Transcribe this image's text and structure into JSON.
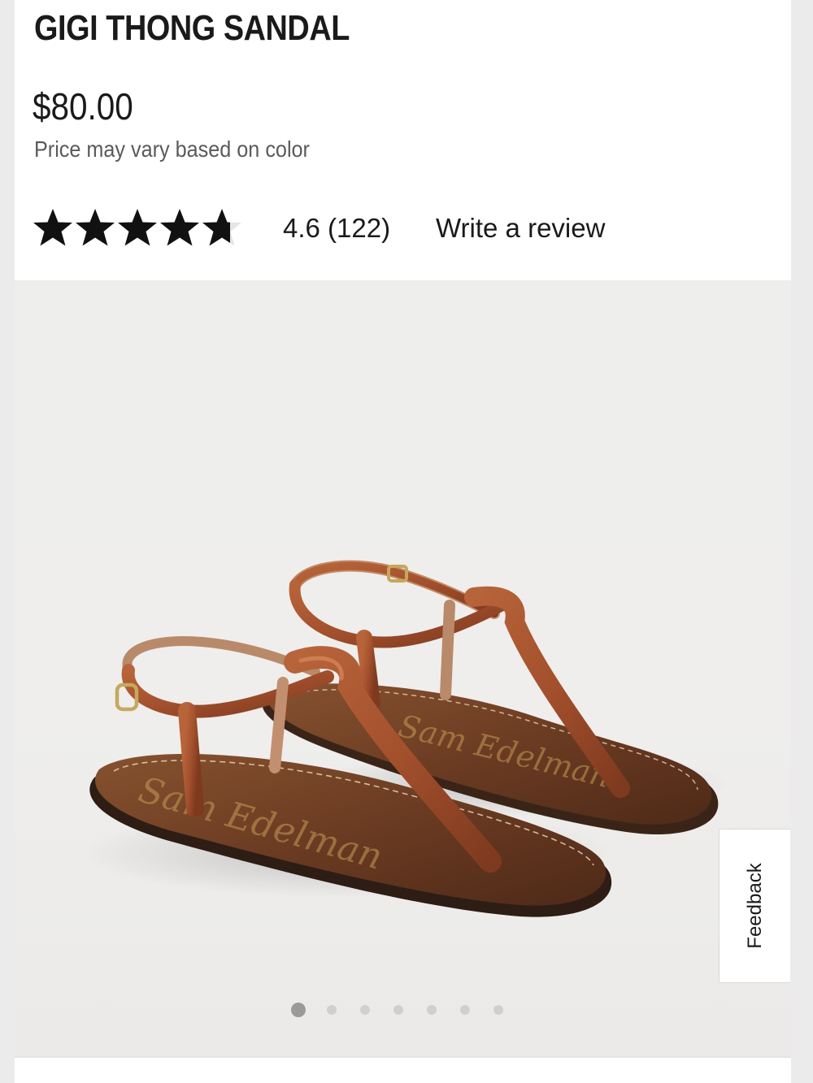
{
  "product": {
    "title": "GIGI THONG SANDAL",
    "price": "$80.00",
    "price_note": "Price may vary based on color"
  },
  "rating": {
    "stars": 4.6,
    "max_stars": 5,
    "summary": "4.6 (122)",
    "write_review_label": "Write a review"
  },
  "gallery": {
    "image_count": 7,
    "active_index": 0
  },
  "feedback": {
    "label": "Feedback"
  },
  "colors": {
    "text": "#1a1a1a",
    "muted_text": "#5a5a5a",
    "image_background": "#eeeeed",
    "leather_strap": "#a3502d",
    "footbed": "#6b3b22",
    "active_dot": "#9a9a9a",
    "inactive_dot": "#cfcfcf"
  }
}
